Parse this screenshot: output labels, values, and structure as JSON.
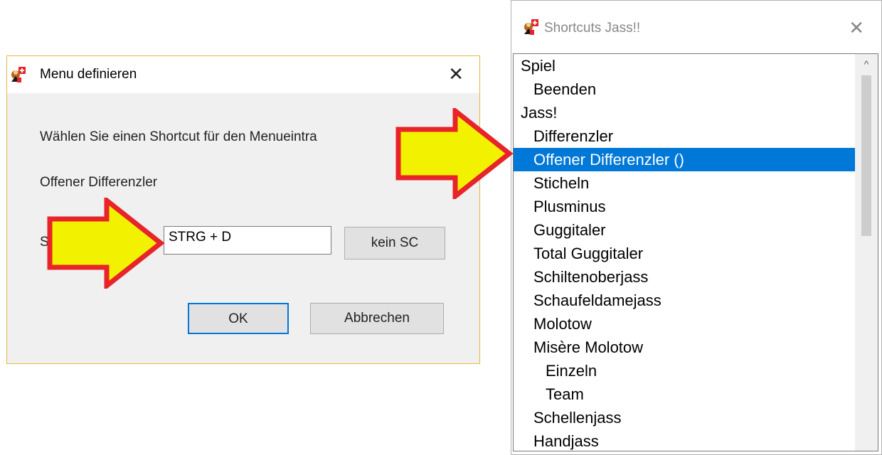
{
  "dialog": {
    "title": "Menu definieren",
    "prompt": "Wählen Sie einen Shortcut für den Menueintra",
    "entry_name": "Offener Differenzler",
    "shortcut_label_visible": "S",
    "shortcut_value": "STRG + D",
    "kein_sc_label": "kein SC",
    "ok_label": "OK",
    "cancel_label": "Abbrechen",
    "close_glyph": "✕"
  },
  "shortcuts_window": {
    "title": "Shortcuts Jass!!",
    "close_glyph": "✕",
    "items": [
      {
        "label": "Spiel",
        "level": 0
      },
      {
        "label": "Beenden",
        "level": 1
      },
      {
        "label": "Jass!",
        "level": 0
      },
      {
        "label": "Differenzler",
        "level": 1
      },
      {
        "label": "Offener Differenzler ()",
        "level": 1,
        "selected": true
      },
      {
        "label": "Sticheln",
        "level": 1
      },
      {
        "label": "Plusminus",
        "level": 1
      },
      {
        "label": "Guggitaler",
        "level": 1
      },
      {
        "label": "Total Guggitaler",
        "level": 1
      },
      {
        "label": "Schiltenoberjass",
        "level": 1
      },
      {
        "label": "Schaufeldamejass",
        "level": 1
      },
      {
        "label": "Molotow",
        "level": 1
      },
      {
        "label": "Misère Molotow",
        "level": 1
      },
      {
        "label": "Einzeln",
        "level": 2
      },
      {
        "label": "Team",
        "level": 2
      },
      {
        "label": "Schellenjass",
        "level": 1
      },
      {
        "label": "Handjass",
        "level": 1
      }
    ],
    "scroll_up_glyph": "^"
  },
  "icons": {
    "app": "jass-app-icon",
    "arrow_color": "#f2f200",
    "arrow_outline": "#e8232a"
  },
  "colors": {
    "selection": "#0078d7",
    "dialog_border": "#e6b93c"
  }
}
